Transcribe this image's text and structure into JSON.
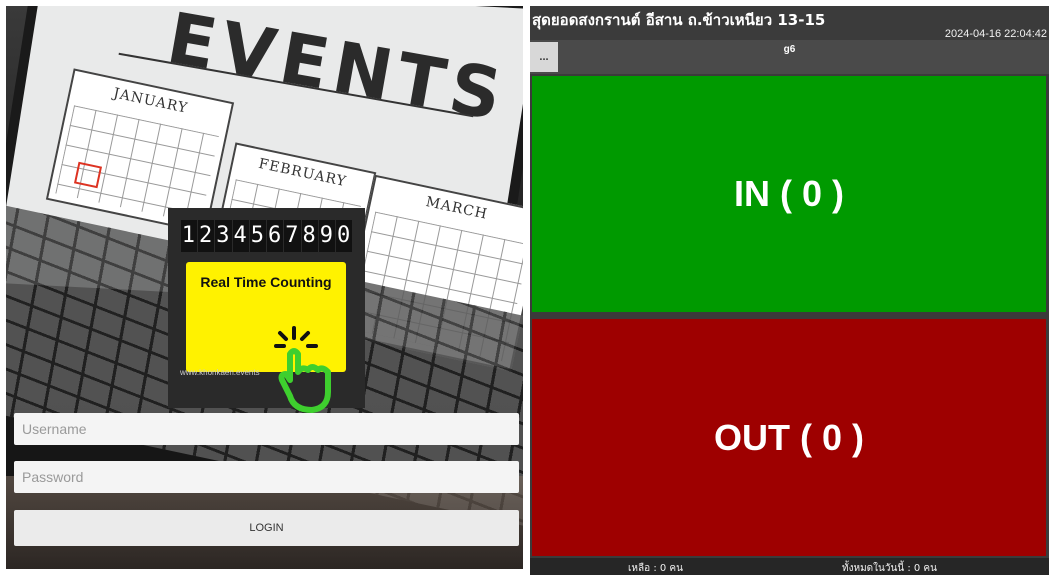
{
  "login": {
    "logo": {
      "digits": [
        "1",
        "2",
        "3",
        "4",
        "5",
        "6",
        "7",
        "8",
        "9",
        "0"
      ],
      "tagline": "Real Time Counting",
      "url": "www.khonkaen.events"
    },
    "background": {
      "headline": "EVENTS",
      "months": [
        "JANUARY",
        "FEBRUARY",
        "MARCH"
      ]
    },
    "username_placeholder": "Username",
    "password_placeholder": "Password",
    "login_label": "LOGIN"
  },
  "counter": {
    "title": "สุดยอดสงกรานต์ อีสาน ถ.ข้าวเหนียว 13-15",
    "datetime": "2024-04-16 22:04:42",
    "menu_label": "...",
    "device": "g6",
    "in_label": "IN ( 0 )",
    "out_label": "OUT ( 0 )",
    "remaining": "เหลือ : 0 คน",
    "total_today": "ทั้งหมดในวันนี้ : 0 คน"
  },
  "colors": {
    "in_green": "#009a00",
    "out_red": "#9e0000",
    "logo_yellow": "#fff200",
    "hand_green": "#3ecf2e"
  }
}
